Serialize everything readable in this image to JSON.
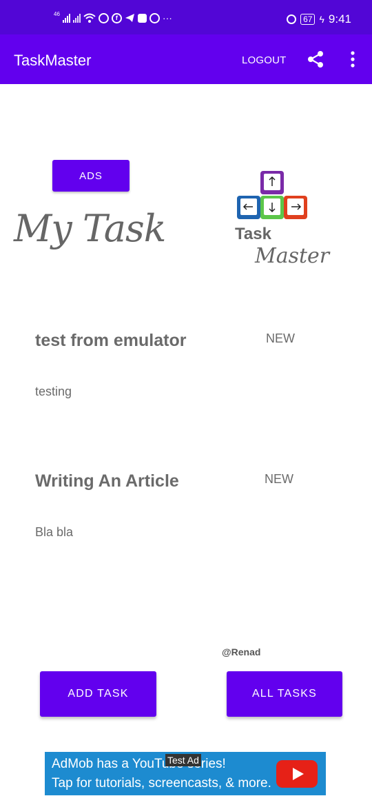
{
  "status_bar": {
    "network": "46",
    "battery": "67",
    "time": "9:41",
    "more": "···",
    "icons": [
      "signal-icon",
      "wifi-icon",
      "whatsapp-icon",
      "facebook-icon",
      "telegram-icon",
      "app-icon",
      "messenger-icon",
      "alarm-icon",
      "charging-icon"
    ]
  },
  "app_bar": {
    "title": "TaskMaster",
    "logout_label": "LOGOUT",
    "icons": [
      "share-icon",
      "more-vert-icon"
    ],
    "color": "#6200ee"
  },
  "hero": {
    "ads_label": "ADS",
    "heading": "My Task",
    "logo_text_1": "Task",
    "logo_text_2": "Master"
  },
  "tasks": [
    {
      "title": "test from emulator",
      "state": "NEW",
      "body": "testing"
    },
    {
      "title": "Writing An Article",
      "state": "NEW",
      "body": "Bla bla"
    }
  ],
  "credit": "@Renad",
  "buttons": {
    "add_task": "ADD TASK",
    "all_tasks": "ALL TASKS"
  },
  "ad": {
    "label": "Test Ad",
    "line1": "AdMob has a YouTube series!",
    "line2": "Tap for tutorials, screencasts, & more.",
    "icon": "youtube-icon"
  }
}
